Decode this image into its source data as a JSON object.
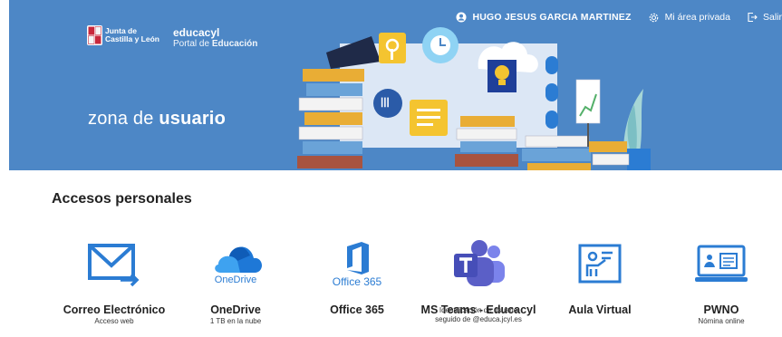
{
  "header": {
    "user_name": "HUGO JESUS GARCIA MARTINEZ",
    "private_area": "Mi área privada",
    "logout": "Salir",
    "org_line1": "Junta de",
    "org_line2": "Castilla y León",
    "portal_title": "educacyl",
    "portal_sub_prefix": "Portal de ",
    "portal_sub_bold": "Educación",
    "zona_prefix": "zona de ",
    "zona_bold": "usuario"
  },
  "section": {
    "title": "Accesos personales"
  },
  "cards": [
    {
      "name": "Correo Electrónico",
      "sub": "Acceso web"
    },
    {
      "name": "OneDrive",
      "sub": "1 TB en la nube",
      "icon_text": "OneDrive"
    },
    {
      "name": "Office 365",
      "sub": "",
      "icon_text": "Office 365"
    },
    {
      "name": "MS Teams - Educacyl",
      "sub1": "Identificación de usuario",
      "sub2": "seguido de @educa.jcyl.es"
    },
    {
      "name": "Aula Virtual",
      "sub": ""
    },
    {
      "name": "PWNO",
      "sub": "Nómina online"
    }
  ],
  "colors": {
    "banner": "#4d87c6",
    "accent": "#2b7cd3",
    "teams": "#5b5fc7"
  }
}
